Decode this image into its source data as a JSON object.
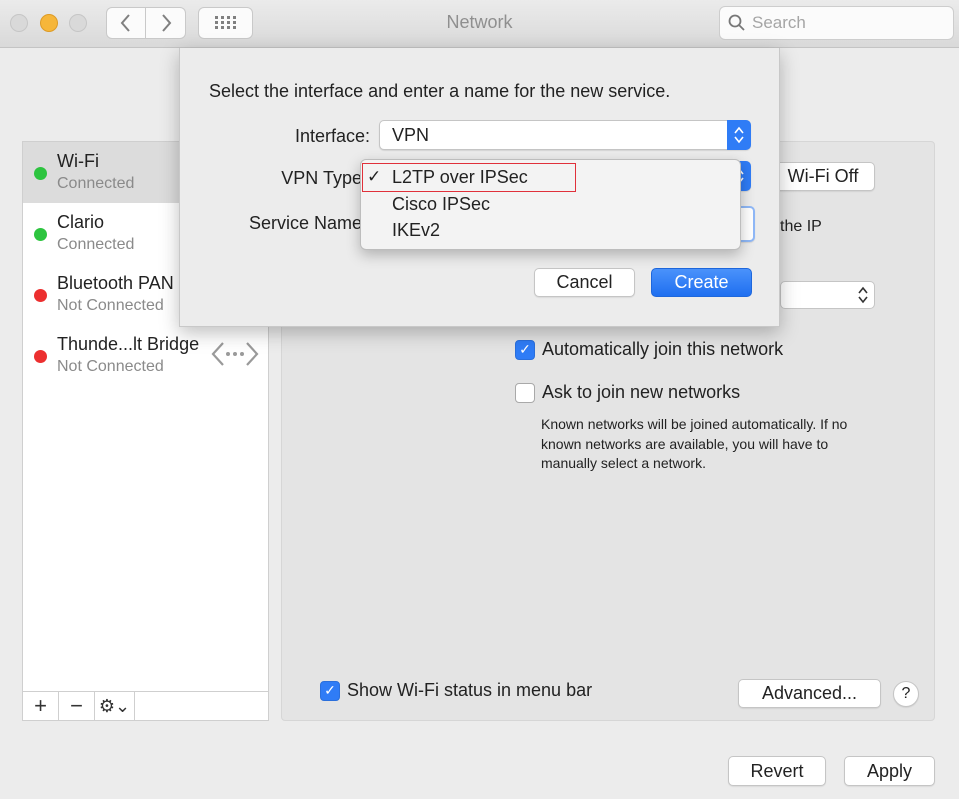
{
  "window": {
    "title": "Network"
  },
  "search": {
    "placeholder": "Search"
  },
  "sidebar": {
    "items": [
      {
        "name": "Wi-Fi",
        "status": "Connected",
        "dot": "#2dc43f"
      },
      {
        "name": "Clario",
        "status": "Connected",
        "dot": "#2dc43f"
      },
      {
        "name": "Bluetooth PAN",
        "status": "Not Connected",
        "dot": "#ec2f2f"
      },
      {
        "name": "Thunde...lt Bridge",
        "status": "Not Connected",
        "dot": "#ec2f2f"
      }
    ],
    "footer": {
      "add": "+",
      "remove": "−",
      "gear": "⚙⌄"
    }
  },
  "panel": {
    "wifi_off_label": "Wi-Fi Off",
    "peek_text": "the IP",
    "auto_join_label": "Automatically join this network",
    "auto_join_checked": true,
    "ask_join_label": "Ask to join new networks",
    "ask_join_checked": false,
    "help_text": "Known networks will be joined automatically. If no known networks are available, you will have to manually select a network.",
    "show_status_label": "Show Wi-Fi status in menu bar",
    "show_status_checked": true,
    "advanced_label": "Advanced...",
    "help_label": "?"
  },
  "sheet": {
    "instruction": "Select the interface and enter a name for the new service.",
    "interface_label": "Interface:",
    "interface_value": "VPN",
    "vpn_type_label": "VPN Type",
    "service_name_label": "Service Name",
    "cancel_label": "Cancel",
    "create_label": "Create"
  },
  "vpn_menu": {
    "selected": "L2TP over IPSec",
    "options": [
      "L2TP over IPSec",
      "Cisco IPSec",
      "IKEv2"
    ],
    "check_glyph": "✓"
  },
  "footer": {
    "revert_label": "Revert",
    "apply_label": "Apply"
  },
  "colors": {
    "accent": "#2f7cf6",
    "highlight_border": "#e0303a"
  }
}
